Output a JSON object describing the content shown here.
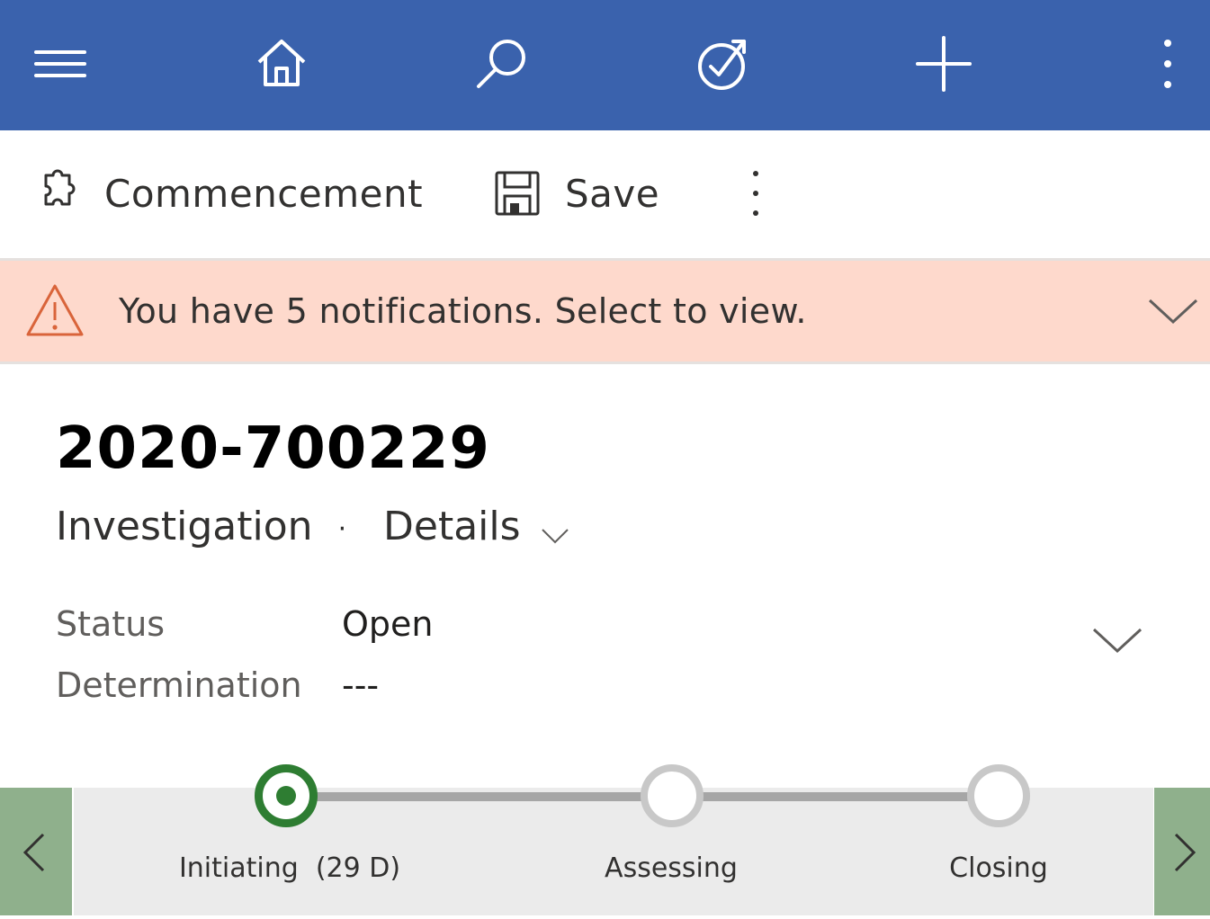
{
  "colors": {
    "navbar": "#3a62ad",
    "notification_bg": "#fed9cc",
    "warning": "#d9643a",
    "active_stage": "#2e7d32",
    "nav_arrow_bg": "#8fb08c"
  },
  "navbar": {
    "icons": [
      "menu-icon",
      "home-icon",
      "search-icon",
      "task-icon",
      "plus-icon",
      "more-icon"
    ]
  },
  "command_bar": {
    "commencement_label": "Commencement",
    "save_label": "Save"
  },
  "notification": {
    "message": "You have 5 notifications. Select to view."
  },
  "record": {
    "title": "2020-700229",
    "entity": "Investigation",
    "separator": "·",
    "form_name": "Details"
  },
  "fields": [
    {
      "label": "Status",
      "value": "Open"
    },
    {
      "label": "Determination",
      "value": "---"
    }
  ],
  "process": {
    "stages": [
      {
        "label": "Initiating  (29 D)",
        "active": true
      },
      {
        "label": "Assessing",
        "active": false
      },
      {
        "label": "Closing",
        "active": false
      }
    ]
  }
}
